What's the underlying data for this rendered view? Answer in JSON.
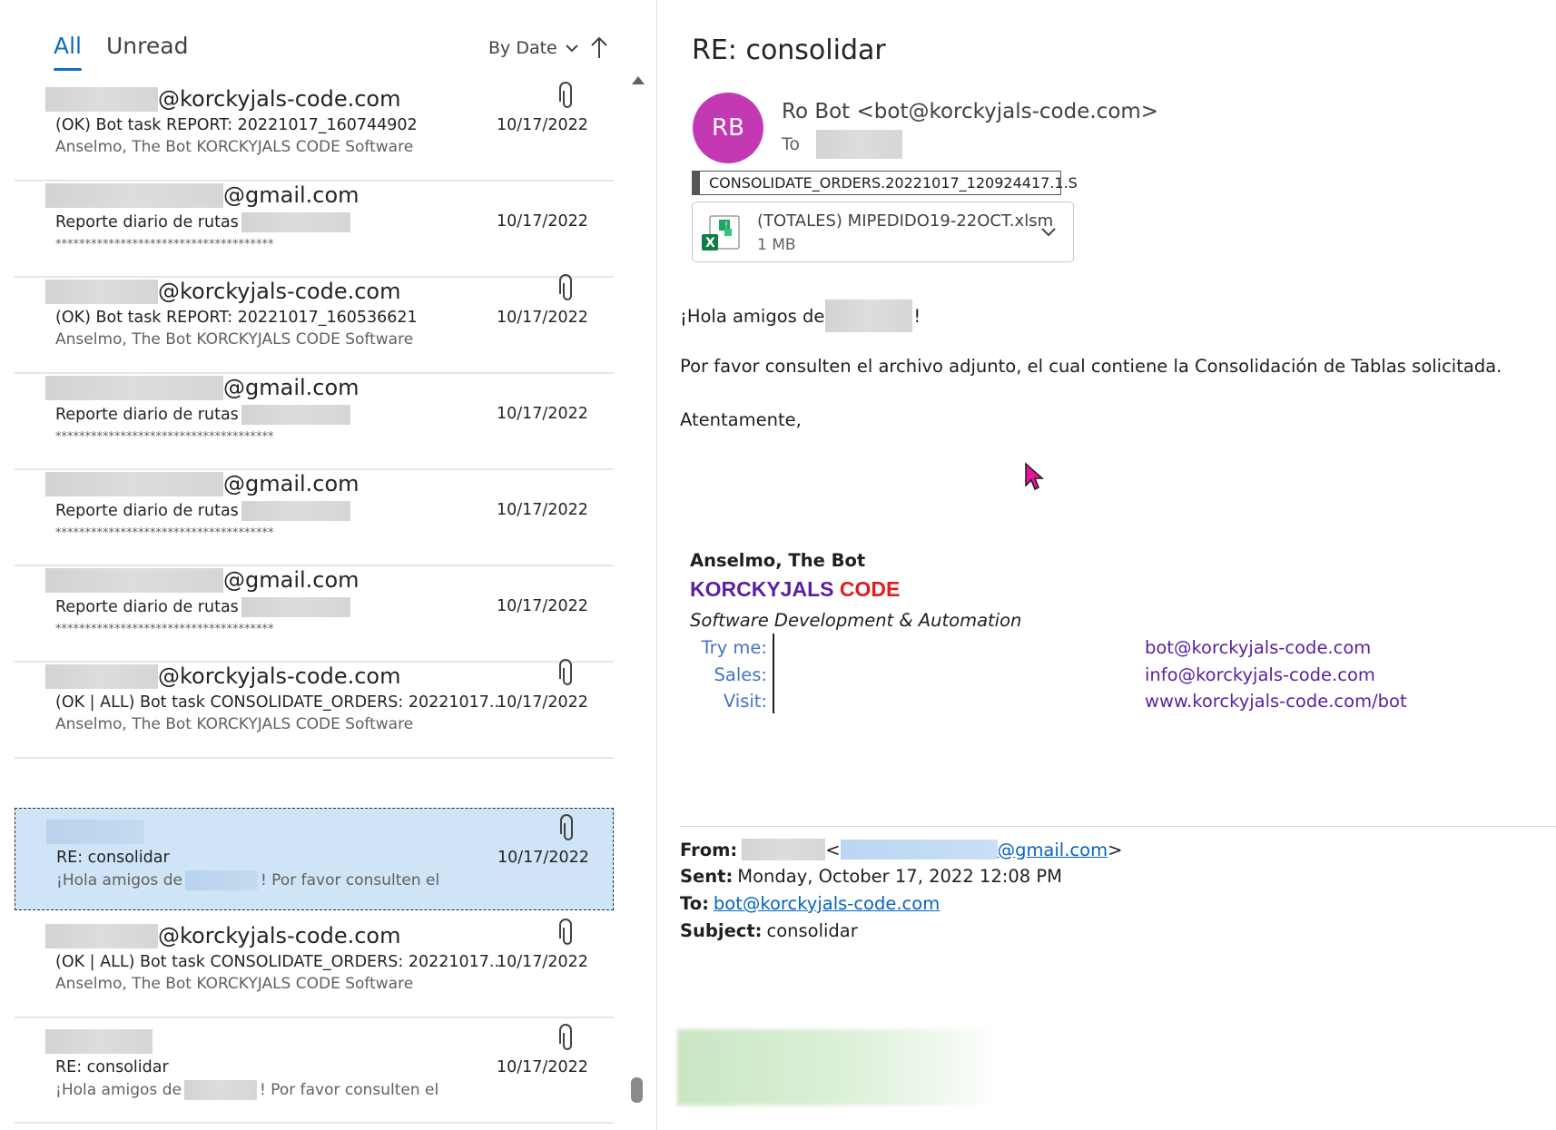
{
  "list": {
    "tabs": [
      {
        "label": "All",
        "active": true
      },
      {
        "label": "Unread",
        "active": false
      }
    ],
    "sort_label": "By Date",
    "messages": [
      {
        "sender_suffix": "@korckyjals-code.com",
        "subject": "(OK) Bot task REPORT: 20221017_160744902",
        "preview": "Anselmo, The Bot  KORCKYJALS CODE  Software",
        "date": "10/17/2022",
        "has_attachment": true,
        "selected": false
      },
      {
        "sender_suffix": "@gmail.com",
        "subject": "Reporte diario de rutas",
        "preview": "*************************************",
        "date": "10/17/2022",
        "has_attachment": false,
        "selected": false
      },
      {
        "sender_suffix": "@korckyjals-code.com",
        "subject": "(OK) Bot task REPORT: 20221017_160536621",
        "preview": "Anselmo, The Bot  KORCKYJALS CODE  Software",
        "date": "10/17/2022",
        "has_attachment": true,
        "selected": false
      },
      {
        "sender_suffix": "@gmail.com",
        "subject": "Reporte diario de rutas",
        "preview": "*************************************",
        "date": "10/17/2022",
        "has_attachment": false,
        "selected": false
      },
      {
        "sender_suffix": "@gmail.com",
        "subject": "Reporte diario de rutas",
        "preview": "*************************************",
        "date": "10/17/2022",
        "has_attachment": false,
        "selected": false
      },
      {
        "sender_suffix": "@gmail.com",
        "subject": "Reporte diario de rutas",
        "preview": "*************************************",
        "date": "10/17/2022",
        "has_attachment": false,
        "selected": false
      },
      {
        "sender_suffix": "@korckyjals-code.com",
        "subject": "(OK | ALL) Bot task CONSOLIDATE_ORDERS: 20221017...",
        "preview": "Anselmo, The Bot  KORCKYJALS CODE  Software",
        "date": "10/17/2022",
        "has_attachment": true,
        "selected": false
      },
      {
        "sender_suffix": "",
        "subject": "RE: consolidar",
        "preview_a": "¡Hola amigos de",
        "preview_b": "!  Por favor consulten el",
        "date": "10/17/2022",
        "has_attachment": true,
        "selected": true
      },
      {
        "sender_suffix": "@korckyjals-code.com",
        "subject": "(OK | ALL) Bot task CONSOLIDATE_ORDERS: 20221017...",
        "preview": "Anselmo, The Bot  KORCKYJALS CODE  Software",
        "date": "10/17/2022",
        "has_attachment": true,
        "selected": false
      },
      {
        "sender_suffix": "",
        "subject": "RE: consolidar",
        "preview_a": "¡Hola amigos de",
        "preview_b": "!  Por favor consulten el",
        "date": "10/17/2022",
        "has_attachment": true,
        "selected": false
      }
    ]
  },
  "reading": {
    "title": "RE: consolidar",
    "avatar_initials": "RB",
    "avatar_color": "#c239b3",
    "from": "Ro Bot <bot@korckyjals-code.com>",
    "to_label": "To",
    "attachment_label": "CONSOLIDATE_ORDERS.20221017_120924417.1.S",
    "attachment": {
      "name": "(TOTALES) MIPEDIDO19-22OCT.xlsm",
      "size": "1 MB",
      "icon": "excel-file-icon"
    },
    "body": {
      "greeting_a": "¡Hola amigos de",
      "greeting_b": "!",
      "line1": "Por favor consulten el archivo adjunto, el cual contiene la Consolidación de Tablas solicitada.",
      "closing": "Atentamente,"
    },
    "signature": {
      "name": "Anselmo, The Bot",
      "company_a": "KORCKYJALS",
      "company_b": "CODE",
      "tagline": "Software Development & Automation",
      "rows": [
        {
          "label": "Try me:",
          "value": "bot@korckyjals-code.com"
        },
        {
          "label": "Sales:",
          "value": "info@korckyjals-code.com"
        },
        {
          "label": "Visit:",
          "value": "www.korckyjals-code.com/bot"
        }
      ]
    },
    "quoted": {
      "from_label": "From:",
      "from_email_suffix": "@gmail.com",
      "sent_label": "Sent:",
      "sent_value": "Monday, October 17, 2022 12:08 PM",
      "to_label": "To:",
      "to_value": "bot@korckyjals-code.com",
      "subject_label": "Subject:",
      "subject_value": "consolidar"
    }
  },
  "colors": {
    "accent": "#0f6cbd",
    "selected_bg": "#cfe4f7",
    "brand_purple": "#5a1fa3",
    "brand_red": "#e21b1b",
    "sig_label": "#4472c4"
  }
}
